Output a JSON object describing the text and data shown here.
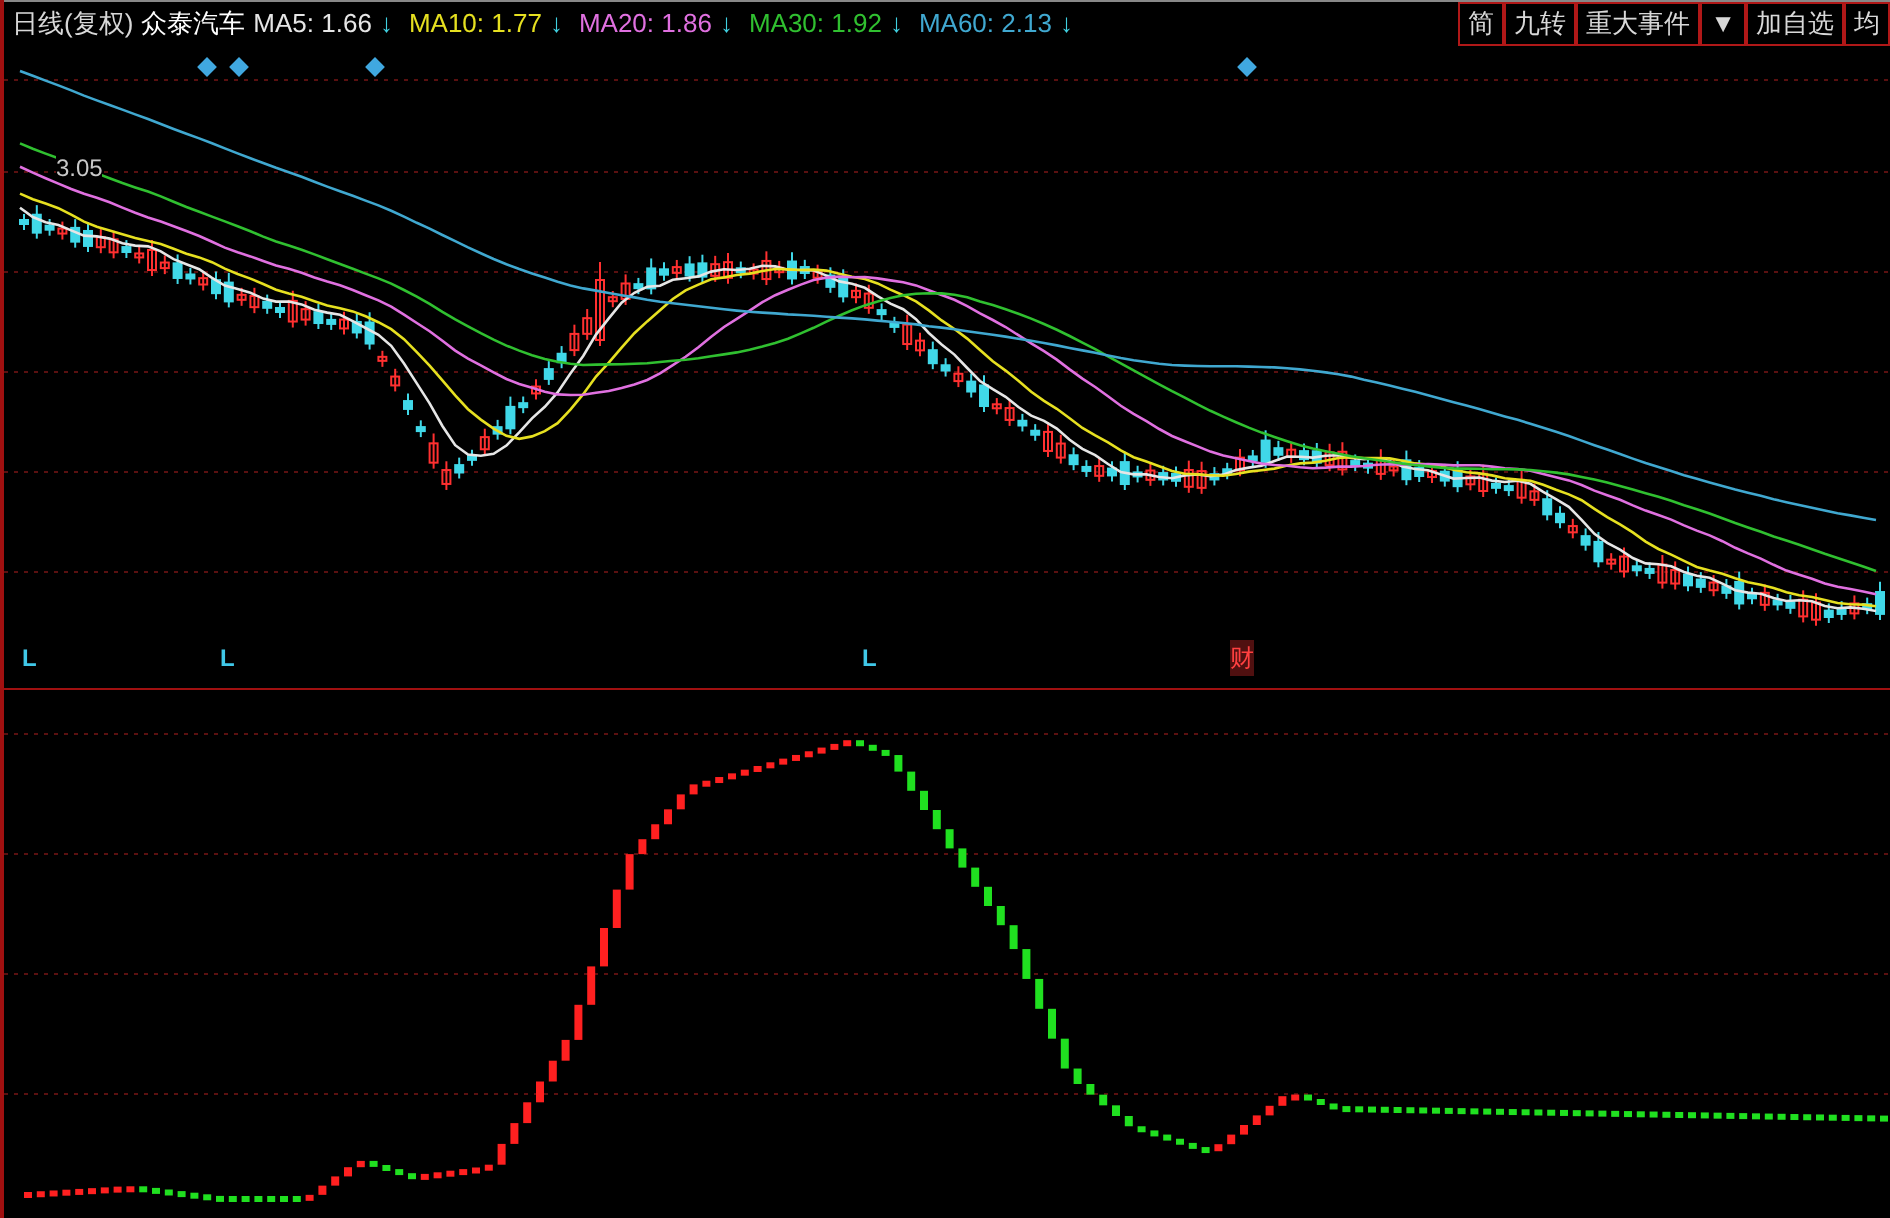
{
  "header": {
    "period": "日线(复权)",
    "stock": "众泰汽车",
    "moving_averages": [
      {
        "label": "MA5:",
        "value": "1.66",
        "arrow": "↓",
        "color": "#e6e6e6"
      },
      {
        "label": "MA10:",
        "value": "1.77",
        "arrow": "↓",
        "color": "#e6e020"
      },
      {
        "label": "MA20:",
        "value": "1.86",
        "arrow": "↓",
        "color": "#e070e0"
      },
      {
        "label": "MA30:",
        "value": "1.92",
        "arrow": "↓",
        "color": "#30c030"
      },
      {
        "label": "MA60:",
        "value": "2.13",
        "arrow": "↓",
        "color": "#40a8d0"
      }
    ]
  },
  "toolbar": [
    {
      "label": "简"
    },
    {
      "label": "九转"
    },
    {
      "label": "重大事件"
    },
    {
      "label": "▼"
    },
    {
      "label": "加自选"
    },
    {
      "label": "均"
    }
  ],
  "price_chart": {
    "high_label": "3.05",
    "signals": [
      {
        "kind": "low",
        "text": "L"
      },
      {
        "kind": "low",
        "text": "L"
      },
      {
        "kind": "low",
        "text": "L"
      },
      {
        "kind": "finance",
        "text": "财"
      }
    ]
  }
}
